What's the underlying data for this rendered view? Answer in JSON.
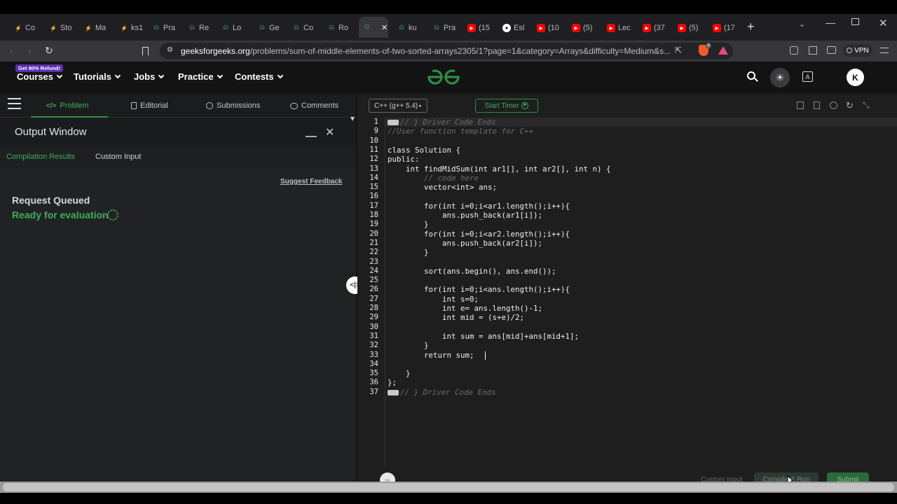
{
  "browser": {
    "tabs": [
      {
        "label": "Co",
        "favicon": "generic-icon"
      },
      {
        "label": "Sto",
        "favicon": "generic-icon"
      },
      {
        "label": "Ma",
        "favicon": "generic-icon"
      },
      {
        "label": "ks1",
        "favicon": "generic-icon"
      },
      {
        "label": "Pra",
        "favicon": "gfg-icon"
      },
      {
        "label": "Re",
        "favicon": "gfg-icon"
      },
      {
        "label": "Lo",
        "favicon": "gfg-icon"
      },
      {
        "label": "Ge",
        "favicon": "gfg-icon"
      },
      {
        "label": "Co",
        "favicon": "gfg-icon"
      },
      {
        "label": "Ro",
        "favicon": "gfg-icon"
      },
      {
        "label": "",
        "favicon": "gfg-icon",
        "active": true
      },
      {
        "label": "ku",
        "favicon": "gfg-icon"
      },
      {
        "label": "Pra",
        "favicon": "gfg-icon"
      },
      {
        "label": "(15",
        "favicon": "youtube-icon"
      },
      {
        "label": "Esl",
        "favicon": "github-icon"
      },
      {
        "label": "(10",
        "favicon": "youtube-icon"
      },
      {
        "label": "(5)",
        "favicon": "youtube-icon"
      },
      {
        "label": "Lec",
        "favicon": "youtube-icon"
      },
      {
        "label": "(37",
        "favicon": "youtube-icon"
      },
      {
        "label": "(5)",
        "favicon": "youtube-icon"
      },
      {
        "label": "(17",
        "favicon": "youtube-icon"
      }
    ],
    "url_host": "geeksforgeeks.org",
    "url_path": "/problems/sum-of-middle-elements-of-two-sorted-arrays2305/1?page=1&category=Arrays&difficulty=Medium&s...",
    "vpn_label": "VPN",
    "brave_badge": "9"
  },
  "site": {
    "promo_badge": "Get 90% Refund!",
    "nav": [
      "Courses",
      "Tutorials",
      "Jobs",
      "Practice",
      "Contests"
    ],
    "avatar_letter": "K"
  },
  "left_panel": {
    "tabs": [
      "Problem",
      "Editorial",
      "Submissions",
      "Comments"
    ],
    "output_title": "Output Window",
    "result_tabs": [
      "Compilation Results",
      "Custom Input"
    ],
    "suggest_feedback": "Suggest Feedback",
    "status_title": "Request Queued",
    "status_sub": "Ready for evaluation"
  },
  "editor": {
    "language": "C++ (g++ 5.4)",
    "timer_label": "Start Timer",
    "lines": [
      {
        "n": "1",
        "fold": true,
        "text": "// } Driver Code Ends",
        "style": "cm"
      },
      {
        "n": "9",
        "text": "//User function template for C++",
        "style": "cm"
      },
      {
        "n": "10",
        "text": ""
      },
      {
        "n": "11",
        "text": "class Solution {"
      },
      {
        "n": "12",
        "text": "public:"
      },
      {
        "n": "13",
        "text": "    int findMidSum(int ar1[], int ar2[], int n) {"
      },
      {
        "n": "14",
        "text": "        // code here",
        "style": "cm"
      },
      {
        "n": "15",
        "text": "        vector<int> ans;"
      },
      {
        "n": "16",
        "text": ""
      },
      {
        "n": "17",
        "text": "        for(int i=0;i<ar1.length();i++){"
      },
      {
        "n": "18",
        "text": "            ans.push_back(ar1[i]);"
      },
      {
        "n": "19",
        "text": "        }"
      },
      {
        "n": "20",
        "text": "        for(int i=0;i<ar2.length();i++){"
      },
      {
        "n": "21",
        "text": "            ans.push_back(ar2[i]);"
      },
      {
        "n": "22",
        "text": "        }"
      },
      {
        "n": "23",
        "text": ""
      },
      {
        "n": "24",
        "text": "        sort(ans.begin(), ans.end());"
      },
      {
        "n": "25",
        "text": ""
      },
      {
        "n": "26",
        "text": "        for(int i=0;i<ans.length();i++){"
      },
      {
        "n": "27",
        "text": "            int s=0;"
      },
      {
        "n": "28",
        "text": "            int e= ans.length()-1;"
      },
      {
        "n": "29",
        "text": "            int mid = (s+e)/2;"
      },
      {
        "n": "30",
        "text": ""
      },
      {
        "n": "31",
        "text": "            int sum = ans[mid]+ans[mid+1];"
      },
      {
        "n": "32",
        "text": "        }"
      },
      {
        "n": "33",
        "text": "        return sum;"
      },
      {
        "n": "34",
        "text": ""
      },
      {
        "n": "35",
        "text": "    }"
      },
      {
        "n": "36",
        "text": "};"
      },
      {
        "n": "37",
        "fold": true,
        "text": "// } Driver Code Ends",
        "style": "cm"
      }
    ],
    "bottom_buttons": [
      "Custom Input",
      "Compile & Run",
      "Submit"
    ]
  },
  "colors": {
    "gfg_green": "#2f8d46",
    "accent_green": "#3fae5a",
    "editor_bg": "#1e1e1e"
  }
}
